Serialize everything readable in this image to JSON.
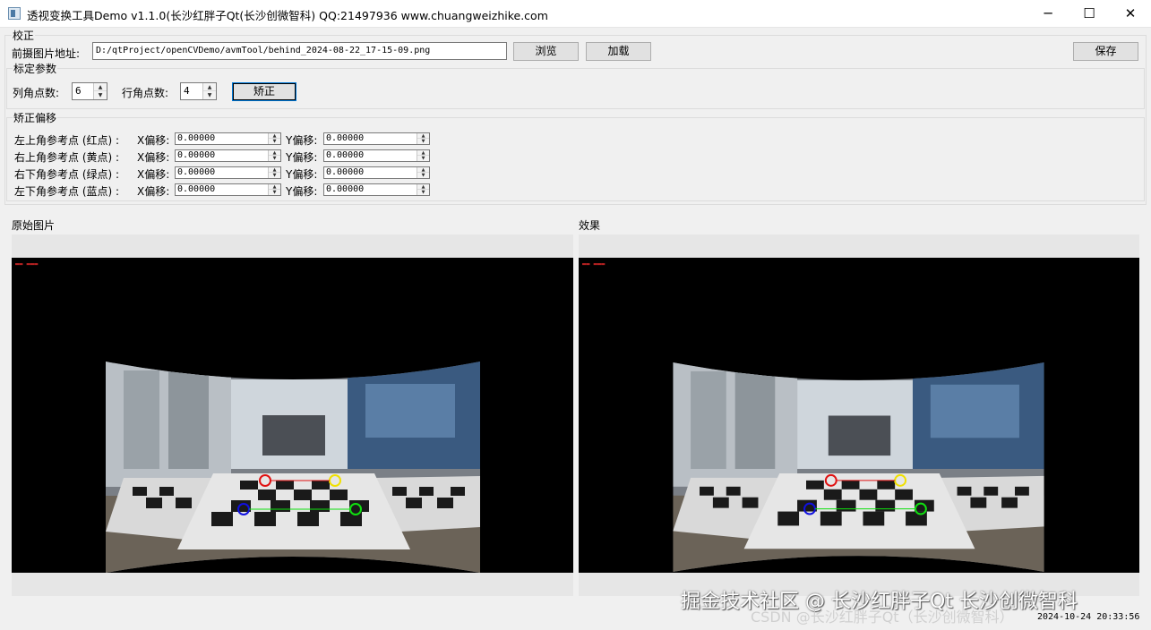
{
  "window": {
    "title": "透视变换工具Demo v1.1.0(长沙红胖子Qt(长沙创微智科) QQ:21497936 www.chuangweizhike.com",
    "minimize_glyph": "─",
    "maximize_glyph": "☐",
    "close_glyph": "✕"
  },
  "correction_group": {
    "title": "校正",
    "path_label": "前摄图片地址:",
    "path_value": "D:/qtProject/openCVDemo/avmTool/behind_2024-08-22_17-15-09.png",
    "browse_label": "浏览",
    "load_label": "加载",
    "save_label": "保存"
  },
  "calib_group": {
    "title": "标定参数",
    "col_label": "列角点数:",
    "col_value": "6",
    "row_label": "行角点数:",
    "row_value": "4",
    "correct_label": "矫正"
  },
  "offset_group": {
    "title": "矫正偏移",
    "x_label": "X偏移:",
    "y_label": "Y偏移:",
    "rows": [
      {
        "label": "左上角参考点 (红点) :",
        "x": "0.00000",
        "y": "0.00000"
      },
      {
        "label": "右上角参考点 (黄点) :",
        "x": "0.00000",
        "y": "0.00000"
      },
      {
        "label": "右下角参考点 (绿点) :",
        "x": "0.00000",
        "y": "0.00000"
      },
      {
        "label": "左下角参考点 (蓝点) :",
        "x": "0.00000",
        "y": "0.00000"
      }
    ]
  },
  "panels": {
    "original_label": "原始图片",
    "result_label": "效果"
  },
  "colors": {
    "red_point": "#e01010",
    "yellow_point": "#f0e000",
    "green_point": "#10e010",
    "blue_point": "#1010e0"
  },
  "overlay": {
    "watermark": "掘金技术社区 @ 长沙红胖子Qt 长沙创微智科",
    "watermark_sub": "CSDN @长沙红胖子Qt（长沙创微智科）",
    "timestamp": "2024-10-24 20:33:56"
  }
}
